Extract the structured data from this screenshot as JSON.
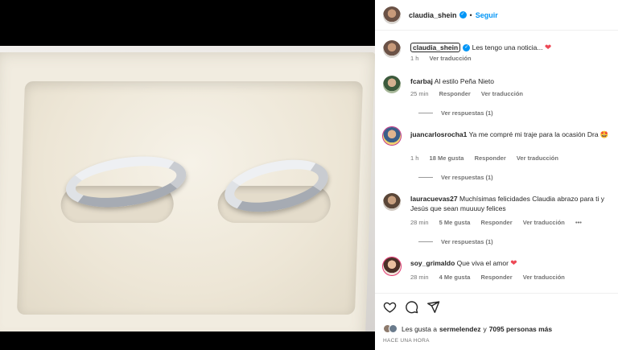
{
  "header": {
    "username": "claudia_shein",
    "follow_label": "Seguir",
    "separator": "•"
  },
  "caption": {
    "username": "claudia_shein",
    "text": "Les tengo una noticia...",
    "heart": "❤",
    "time": "1 h",
    "translate": "Ver traducción"
  },
  "comments": [
    {
      "username": "fcarbaj",
      "text": "Al estilo Peña Nieto",
      "time": "25 min",
      "likes": "",
      "reply": "Responder",
      "translate": "Ver traducción",
      "replies": "Ver respuestas (1)"
    },
    {
      "username": "juancarlosrocha1",
      "text": "Ya me compré mi traje para la ocasión Dra",
      "emoji": "🤩",
      "time": "1 h",
      "likes": "18 Me gusta",
      "reply": "Responder",
      "translate": "Ver traducción",
      "replies": "Ver respuestas (1)"
    },
    {
      "username": "lauracuevas27",
      "text": "Muchísimas felicidades Claudia abrazo para ti y Jesús que sean muuuuy felices",
      "time": "28 min",
      "likes": "5 Me gusta",
      "reply": "Responder",
      "translate": "Ver traducción",
      "more": "•••",
      "replies": "Ver respuestas (1)"
    },
    {
      "username": "soy_grimaldo",
      "text": "Que viva el amor",
      "heart": "❤",
      "time": "28 min",
      "likes": "4 Me gusta",
      "reply": "Responder",
      "translate": "Ver traducción"
    }
  ],
  "footer": {
    "likes_prefix": "Les gusta a",
    "likes_user": "sermelendez",
    "likes_conj": "y",
    "likes_count": "7095 personas más",
    "timestamp": "HACE UNA HORA"
  },
  "icons": {
    "like": "heart-outline-icon",
    "comment": "comment-icon",
    "share": "send-icon"
  }
}
